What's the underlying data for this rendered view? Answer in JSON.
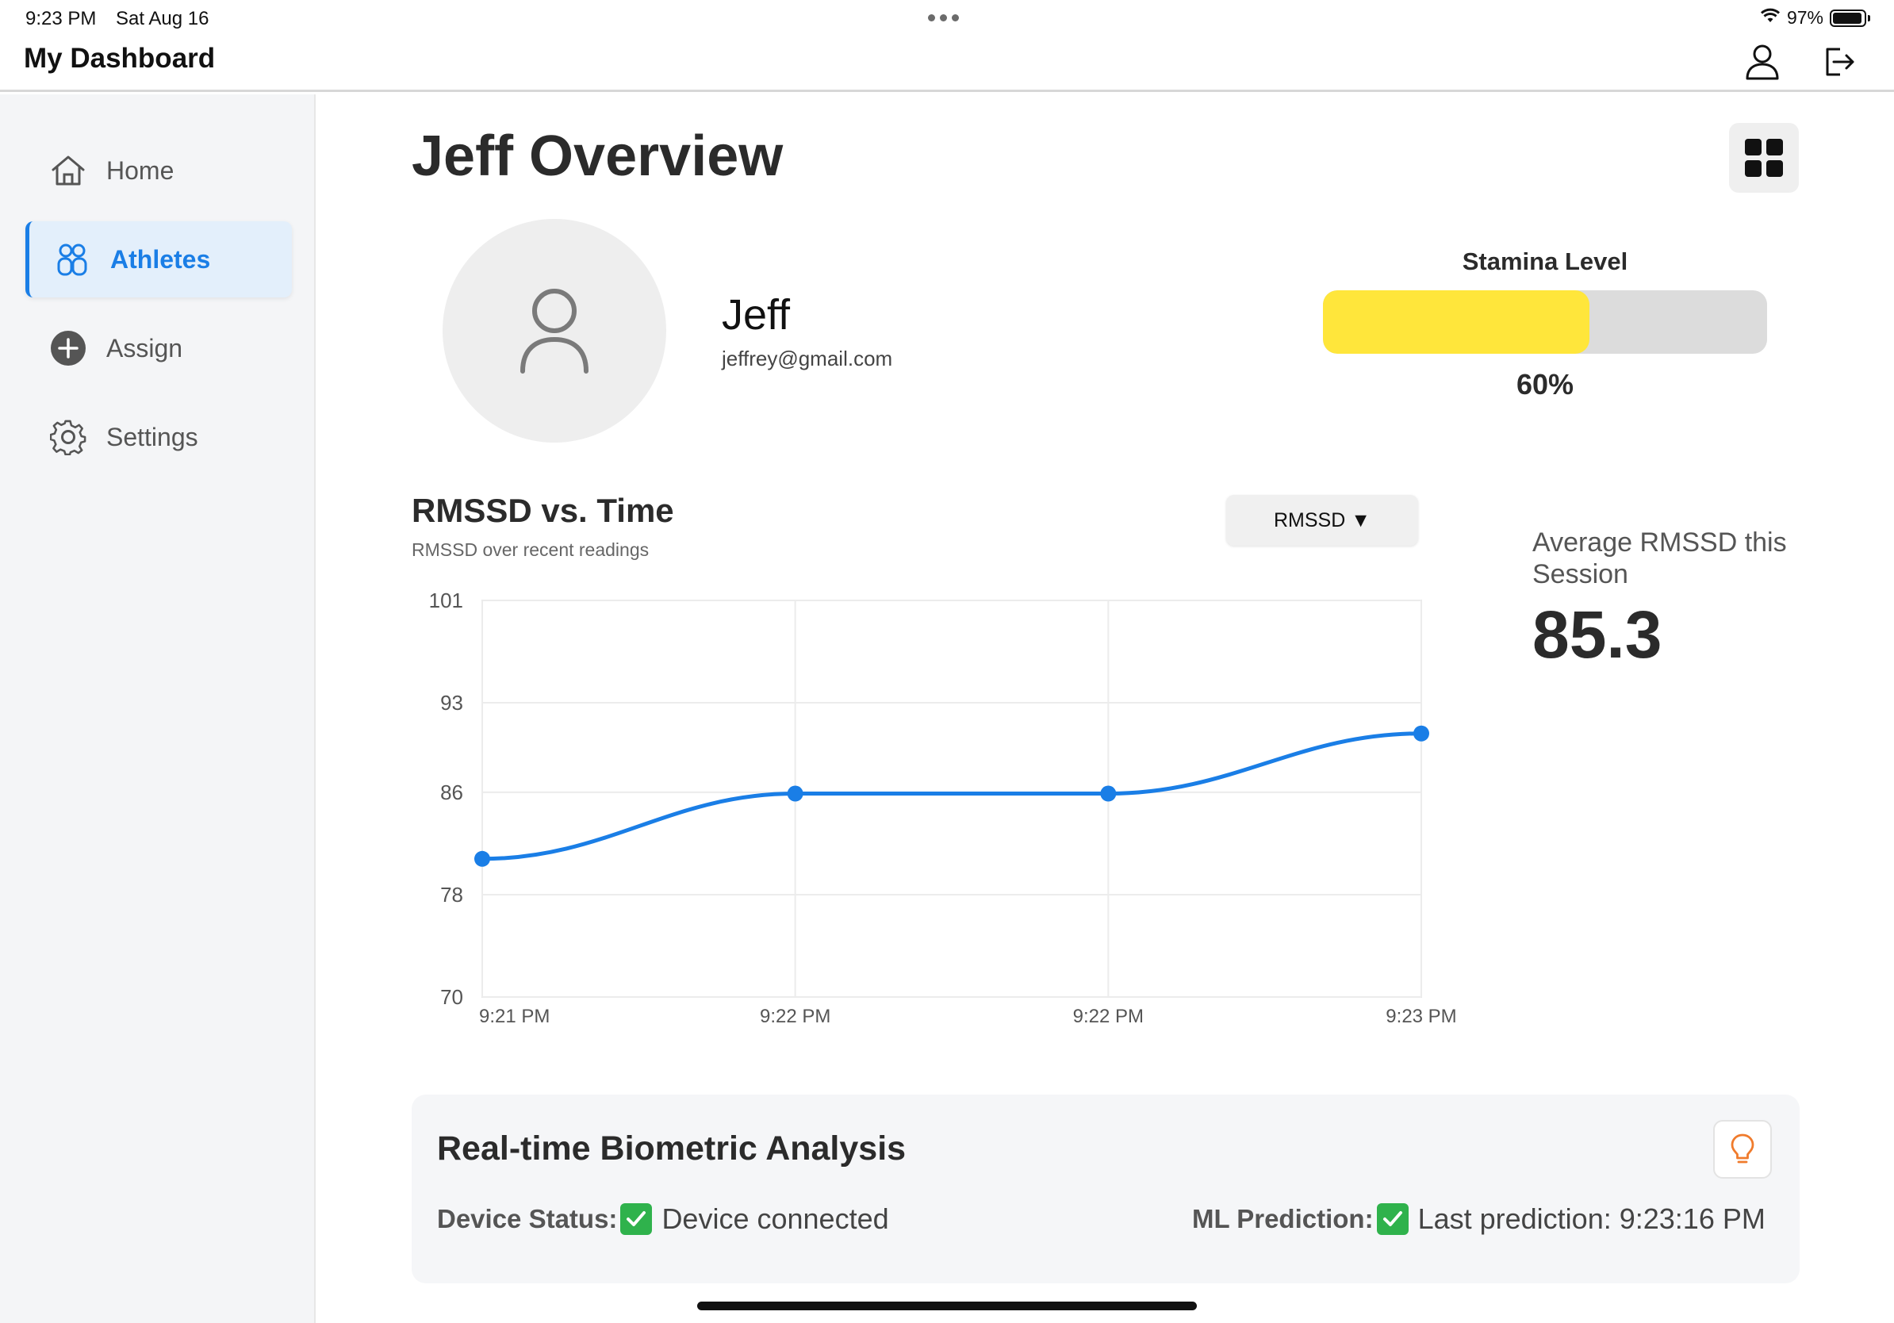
{
  "status_bar": {
    "time": "9:23 PM",
    "date": "Sat Aug 16",
    "battery": "97%"
  },
  "header": {
    "title": "My Dashboard"
  },
  "sidebar": {
    "items": [
      {
        "label": "Home",
        "icon": "home-icon",
        "active": false
      },
      {
        "label": "Athletes",
        "icon": "people-icon",
        "active": true
      },
      {
        "label": "Assign",
        "icon": "plus-circle-icon",
        "active": false
      },
      {
        "label": "Settings",
        "icon": "gear-icon",
        "active": false
      }
    ]
  },
  "main": {
    "title": "Jeff Overview",
    "athlete": {
      "name": "Jeff",
      "email": "jeffrey@gmail.com"
    },
    "stamina": {
      "label": "Stamina Level",
      "value_text": "60%",
      "fraction": 0.6,
      "fill_color": "#ffe63b"
    },
    "metric_select": {
      "value": "RMSSD ▼"
    },
    "average": {
      "label": "Average RMSSD this Session",
      "value": "85.3"
    }
  },
  "chart_data": {
    "type": "line",
    "title": "RMSSD vs. Time",
    "subtitle": "RMSSD over recent readings",
    "xlabel": "",
    "ylabel": "",
    "ylim": [
      70,
      101
    ],
    "y_ticks": [
      "101",
      "93",
      "86",
      "78",
      "70"
    ],
    "x_tick_labels": [
      "9:21 PM",
      "9:22 PM",
      "9:22 PM",
      "9:23 PM"
    ],
    "values": [
      80.8,
      85.9,
      85.9,
      90.6
    ],
    "color": "#1a7ee6",
    "grid": true,
    "legend": "none"
  },
  "analysis": {
    "title": "Real-time Biometric Analysis",
    "device_status_label": "Device Status:",
    "device_status_value": "Device connected",
    "ml_label": "ML Prediction:",
    "ml_value": "Last prediction: 9:23:16 PM"
  },
  "colors": {
    "accent": "#1a7ee6",
    "sidebar_bg": "#f4f5f7",
    "check_green": "#2fb24c",
    "bulb_orange": "#f07b2c"
  }
}
